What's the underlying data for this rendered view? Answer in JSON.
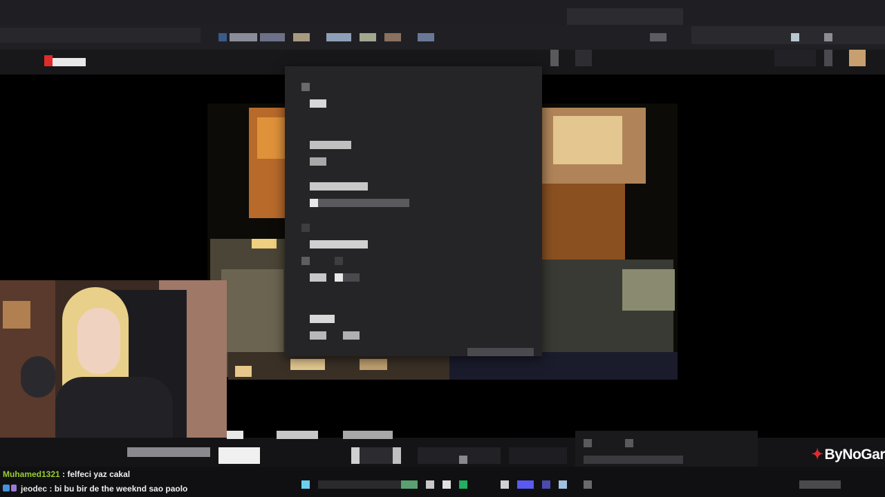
{
  "chat": {
    "messages": [
      {
        "username": "Muhamed1321",
        "separator": " : ",
        "text": "felfeci yaz cakal"
      },
      {
        "username": "jeodec",
        "separator": " : ",
        "text": "bi bu bir de the weeknd sao paolo"
      }
    ]
  },
  "watermark": {
    "text": "ByNoGar"
  },
  "colors": {
    "accent_red": "#e02b2b",
    "username_green": "#9acd32",
    "menu_bg": "#252527",
    "page_bg": "#0e0e10"
  },
  "icons": {
    "record": "record-icon",
    "logo": "bynogar-logo-icon"
  }
}
